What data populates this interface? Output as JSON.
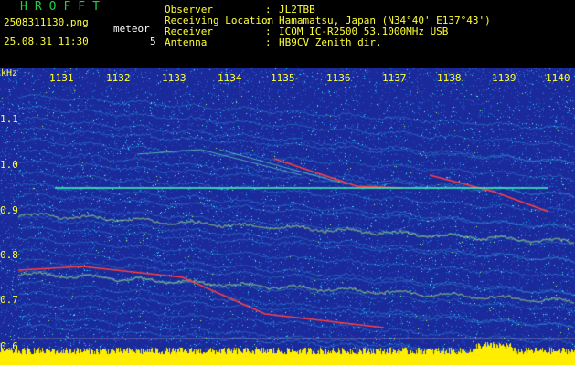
{
  "header": {
    "title": "HROFFT",
    "filename": "2508311130.png",
    "timestamp": "25.08.31 11:30",
    "meteor_label": "meteor",
    "meteor_count": "5"
  },
  "info": [
    {
      "label": "Observer",
      "sep": ":",
      "value": "JL2TBB"
    },
    {
      "label": "Receiving Location",
      "sep": ":",
      "value": "Hamamatsu, Japan (N34°40' E137°43')"
    },
    {
      "label": "Receiver",
      "sep": ":",
      "value": "ICOM IC-R2500 53.1000MHz USB"
    },
    {
      "label": "Antenna",
      "sep": ":",
      "value": "HB9CV Zenith dir."
    }
  ],
  "axes": {
    "y_unit": "kHz",
    "x_ticks": [
      "1131",
      "1132",
      "1133",
      "1134",
      "1135",
      "1136",
      "1137",
      "1138",
      "1139",
      "1140"
    ],
    "y_ticks": [
      "1.1",
      "1.0",
      "0.9",
      "0.8",
      "0.7",
      "0.6"
    ]
  },
  "colors": {
    "background": "#000000",
    "spectrogram_base": "#1a2a9a",
    "noise_hi": "#22aaff",
    "signal": "#ff4040",
    "carrier": "#40ffb0",
    "baseline": "#ffee00",
    "label_yellow": "#ffff33",
    "label_green": "#22cc44"
  }
}
